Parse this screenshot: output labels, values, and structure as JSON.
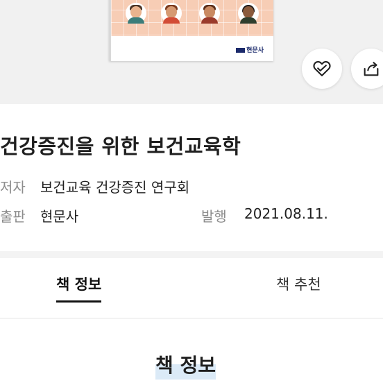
{
  "cover": {
    "publisher_logo_text": "현문사"
  },
  "actions": {
    "like_icon": "heart-icon",
    "share_icon": "share-icon"
  },
  "book": {
    "title": "건강증진을 위한 보건교육학",
    "author_label": "저자",
    "author": "보건교육 건강증진 연구회",
    "publisher_label": "출판",
    "publisher": "현문사",
    "published_label": "발행",
    "published_date": "2021.08.11."
  },
  "tabs": [
    {
      "label": "책 정보",
      "active": true
    },
    {
      "label": "책 추천",
      "active": false
    }
  ],
  "section": {
    "heading": "책 정보"
  },
  "colors": {
    "cover_pattern": "#f7cdb5",
    "heading_highlight": "#dbeaf7",
    "publisher_brand": "#1b2a6b"
  }
}
